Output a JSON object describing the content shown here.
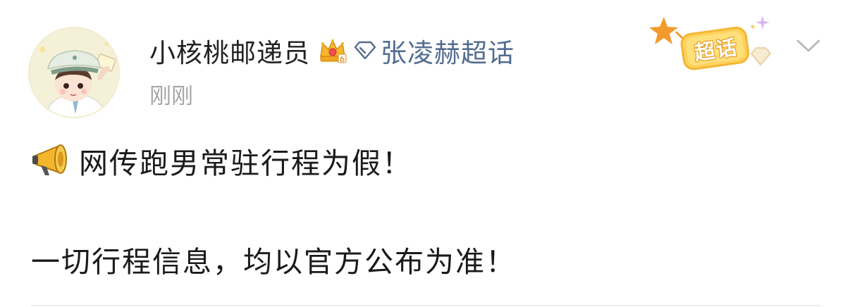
{
  "post": {
    "username": "小核桃邮递员",
    "topic": "张凌赫超话",
    "timestamp": "刚刚",
    "badge_label": "超话",
    "content": {
      "line1": "网传跑男常驻行程为假！",
      "line2": "一切行程信息，均以官方公布为准！"
    }
  },
  "icons": {
    "avatar": "cartoon-mailman-avatar",
    "crown": "crown-level-icon",
    "diamond": "diamond-icon",
    "megaphone": "megaphone-icon",
    "chevron": "chevron-down-icon"
  },
  "colors": {
    "topic_link": "#526c8f",
    "timestamp": "#a6a6a6",
    "badge": "#f5c13d"
  }
}
